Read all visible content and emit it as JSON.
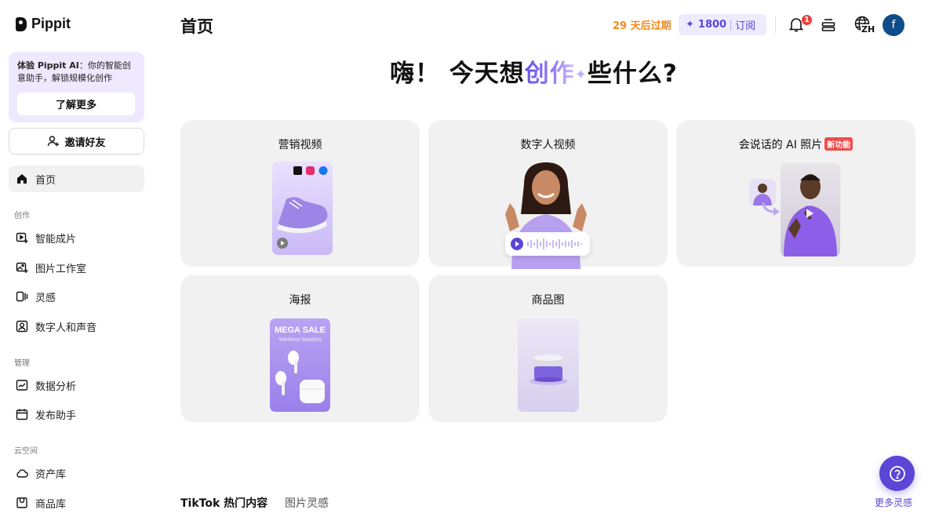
{
  "brand": {
    "name": "Pippit"
  },
  "promo": {
    "title": "体验 Pippit AI",
    "text": "：你的智能创意助手，解锁规模化创作",
    "button": "了解更多"
  },
  "invite": {
    "label": "邀请好友"
  },
  "nav": {
    "home": "首页",
    "section_create": "创作",
    "smart_video": "智能成片",
    "image_studio": "图片工作室",
    "inspiration": "灵感",
    "avatar_voice": "数字人和声音",
    "section_manage": "管理",
    "analytics": "数据分析",
    "publisher": "发布助手",
    "section_cloud": "云空间",
    "assets": "资产库",
    "products": "商品库"
  },
  "header": {
    "title": "首页",
    "expiry": "29 天后过期",
    "credits": "1800",
    "subscribe": "订阅",
    "notifications": "1",
    "lang": "ZH",
    "avatar": "f"
  },
  "hero": {
    "part1": "嗨！ 今天想",
    "highlight": "创作",
    "spark": "✦",
    "part2": "些什么?"
  },
  "cards": [
    {
      "title": "营销视频"
    },
    {
      "title": "数字人视频"
    },
    {
      "title": "会说话的 AI 照片",
      "tag": "新功能"
    },
    {
      "title": "海报",
      "poster_title": "MEGA SALE",
      "poster_sub": "Wireless headset"
    },
    {
      "title": "商品图"
    }
  ],
  "bottom": {
    "tab1": "TikTok 热门内容",
    "tab2": "图片灵感",
    "more": "更多灵感"
  },
  "colors": {
    "accent": "#5b46d6",
    "orange": "#f08a1c",
    "card_bg": "#f1f1f1",
    "purple_soft": "#efe9ff"
  }
}
